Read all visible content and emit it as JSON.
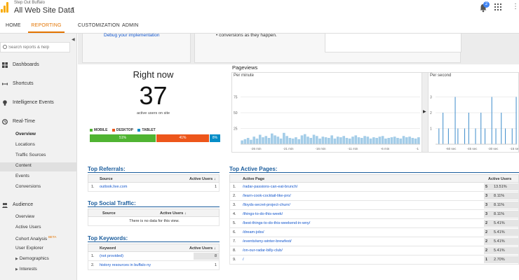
{
  "header": {
    "account_small": "Step Out Buffalo",
    "account_big": "All Web Site Data",
    "notifications_count": "2"
  },
  "tabs": [
    {
      "label": "HOME"
    },
    {
      "label": "REPORTING"
    },
    {
      "label": "CUSTOMIZATION"
    },
    {
      "label": "ADMIN"
    }
  ],
  "sidebar": {
    "search_placeholder": "Search reports & help",
    "sections": {
      "dashboards": "Dashboards",
      "shortcuts": "Shortcuts",
      "intelligence": "Intelligence Events",
      "realtime": "Real-Time",
      "audience": "Audience"
    },
    "realtime_items": [
      "Overview",
      "Locations",
      "Traffic Sources",
      "Content",
      "Events",
      "Conversions"
    ],
    "audience_items": {
      "overview": "Overview",
      "active_users": "Active Users",
      "cohort": "Cohort Analysis",
      "beta": "BETA",
      "user_explorer": "User Explorer",
      "demographics": "Demographics",
      "interests": "Interests"
    }
  },
  "top_panel": {
    "debug_link": "Debug your implementation",
    "bullet_text": "conversions as they happen."
  },
  "right_now": {
    "title": "Right now",
    "count": "37",
    "subtitle": "active users on site",
    "legend": [
      {
        "label": "MOBILE",
        "color": "#50b432"
      },
      {
        "label": "DESKTOP",
        "color": "#ed561b"
      },
      {
        "label": "TABLET",
        "color": "#058dc7"
      }
    ],
    "segments": [
      {
        "label": "51%",
        "value": 51,
        "color": "#50b432"
      },
      {
        "label": "41%",
        "value": 41,
        "color": "#ed561b"
      },
      {
        "label": "8%",
        "value": 8,
        "color": "#058dc7"
      }
    ]
  },
  "pageviews": {
    "title": "Pageviews",
    "per_minute_label": "Per minute",
    "per_second_label": "Per second"
  },
  "chart_data": [
    {
      "type": "bar",
      "title": "Per minute",
      "y_ticks": [
        "75",
        "50",
        "25"
      ],
      "ylim": [
        0,
        100
      ],
      "x_ticks": [
        "-26 min",
        "-21 min",
        "-16 min",
        "-11 min",
        "-6 min",
        "-1"
      ],
      "values": [
        6,
        8,
        10,
        7,
        12,
        9,
        15,
        11,
        13,
        10,
        17,
        14,
        12,
        9,
        18,
        13,
        10,
        9,
        11,
        8,
        14,
        16,
        12,
        10,
        15,
        13,
        9,
        12,
        11,
        10,
        14,
        9,
        12,
        11,
        13,
        10,
        9,
        12,
        14,
        11,
        10,
        13,
        12,
        9,
        11,
        10,
        12,
        13,
        9,
        10,
        11,
        12,
        10,
        9,
        13,
        11,
        12,
        10,
        9,
        11
      ]
    },
    {
      "type": "bar",
      "title": "Per second",
      "y_ticks": [
        "3",
        "2",
        "1"
      ],
      "ylim": [
        0,
        4
      ],
      "x_ticks": [
        "-60 sec",
        "-45 sec",
        "-30 sec",
        "-15 se"
      ],
      "values": [
        0,
        0,
        1,
        0,
        0,
        2,
        0,
        0,
        0,
        1,
        0,
        0,
        0,
        0,
        3,
        0,
        1,
        0,
        0,
        0,
        0,
        1,
        0,
        0,
        2,
        0,
        0,
        0,
        0,
        1,
        0,
        0,
        0,
        2,
        0,
        0,
        1,
        0,
        0,
        0,
        0,
        3,
        0,
        0,
        1,
        0,
        0,
        0,
        2,
        0,
        0,
        1,
        0,
        0,
        0,
        0,
        1,
        0,
        0,
        3
      ]
    }
  ],
  "top_referrals": {
    "title": "Top Referrals:",
    "col_source": "Source",
    "col_active": "Active Users",
    "rows": [
      {
        "num": "1.",
        "source": "outlook.live.com",
        "users": "1"
      }
    ]
  },
  "top_social": {
    "title": "Top Social Traffic:",
    "col_source": "Source",
    "col_active": "Active Users",
    "empty": "There is no data for this view."
  },
  "top_keywords": {
    "title": "Top Keywords:",
    "col_keyword": "Keyword",
    "col_active": "Active Users",
    "rows": [
      {
        "num": "1.",
        "keyword": "(not provided)",
        "users": "8"
      },
      {
        "num": "2.",
        "keyword": "history resources in buffalo ny",
        "users": "1"
      }
    ]
  },
  "top_pages": {
    "title": "Top Active Pages:",
    "col_page": "Active Page",
    "col_active": "Active Users",
    "rows": [
      {
        "num": "1.",
        "page": "/radar-passions-can-eat-brunch/",
        "users": "5",
        "pct": "13.51%"
      },
      {
        "num": "2.",
        "page": "/learn-cook-cocktail-like-pro/",
        "users": "3",
        "pct": "8.11%"
      },
      {
        "num": "3.",
        "page": "/lloyds-secret-project-churn/",
        "users": "3",
        "pct": "8.11%"
      },
      {
        "num": "4.",
        "page": "/things-to-do-this-week/",
        "users": "3",
        "pct": "8.11%"
      },
      {
        "num": "5.",
        "page": "/best-things-to-do-this-weekend-in-wny/",
        "users": "2",
        "pct": "5.41%"
      },
      {
        "num": "6.",
        "page": "/dream-jobs/",
        "users": "2",
        "pct": "5.41%"
      },
      {
        "num": "7.",
        "page": "/events/wny-winter-brewfest/",
        "users": "2",
        "pct": "5.41%"
      },
      {
        "num": "8.",
        "page": "/on-our-radar-billy-club/",
        "users": "2",
        "pct": "5.41%"
      },
      {
        "num": "9.",
        "page": "/",
        "users": "1",
        "pct": "2.70%"
      }
    ]
  }
}
